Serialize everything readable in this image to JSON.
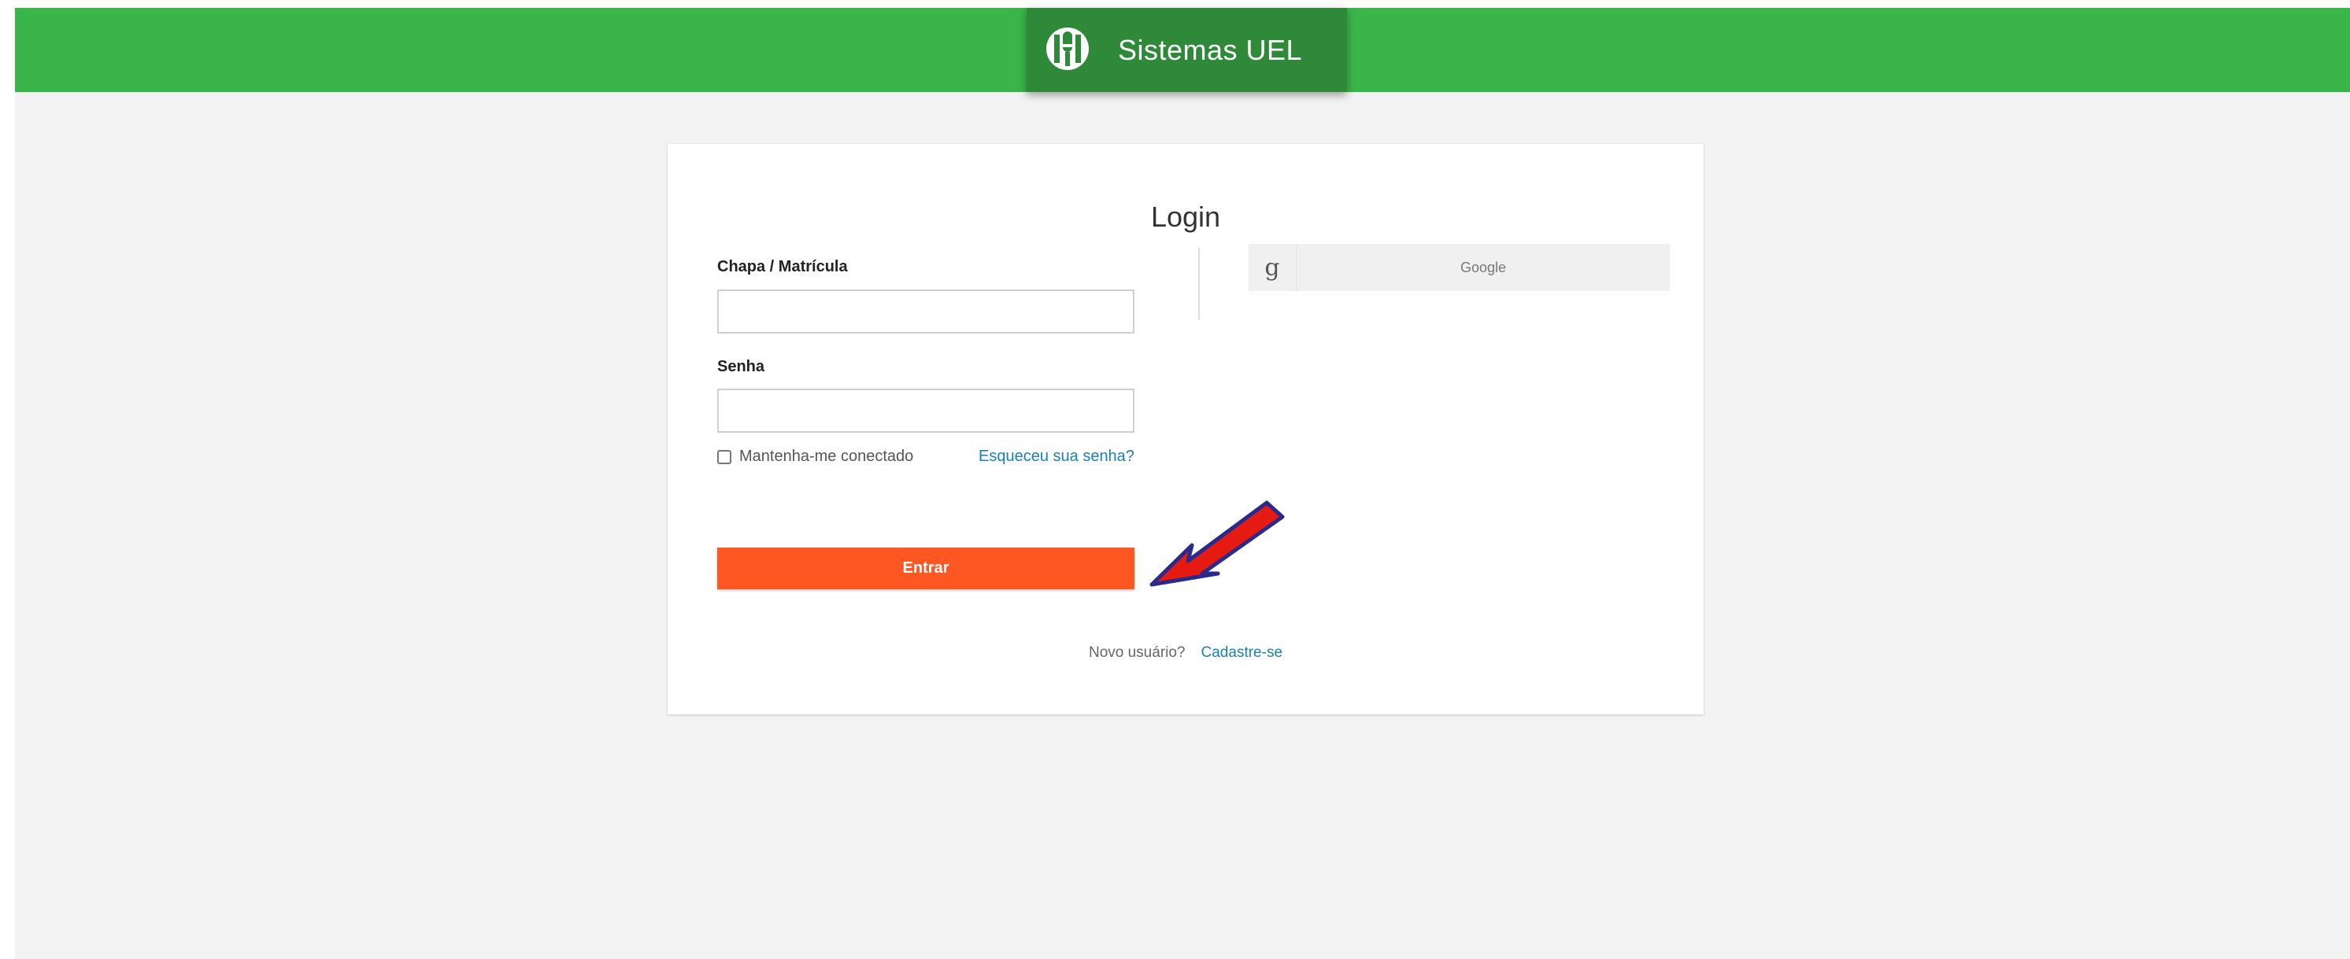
{
  "header": {
    "brand_name": "Sistemas UEL",
    "color": "#3ab54a",
    "brand_badge_color": "#2e8a39"
  },
  "login": {
    "title": "Login",
    "fields": {
      "chapa": {
        "label": "Chapa / Matrícula",
        "value": "",
        "placeholder": ""
      },
      "senha": {
        "label": "Senha",
        "value": "",
        "placeholder": ""
      }
    },
    "remember_label": "Mantenha-me conectado",
    "remember_checked": false,
    "forgot_label": "Esqueceu sua senha?",
    "submit_label": "Entrar",
    "submit_color": "#ff5722",
    "new_user_text": "Novo usuário?",
    "signup_label": "Cadastre-se",
    "google": {
      "icon": "google-g-icon",
      "label": "Google"
    }
  },
  "annotation": {
    "icon": "red-arrow-pointer",
    "color": "#e51b12"
  }
}
